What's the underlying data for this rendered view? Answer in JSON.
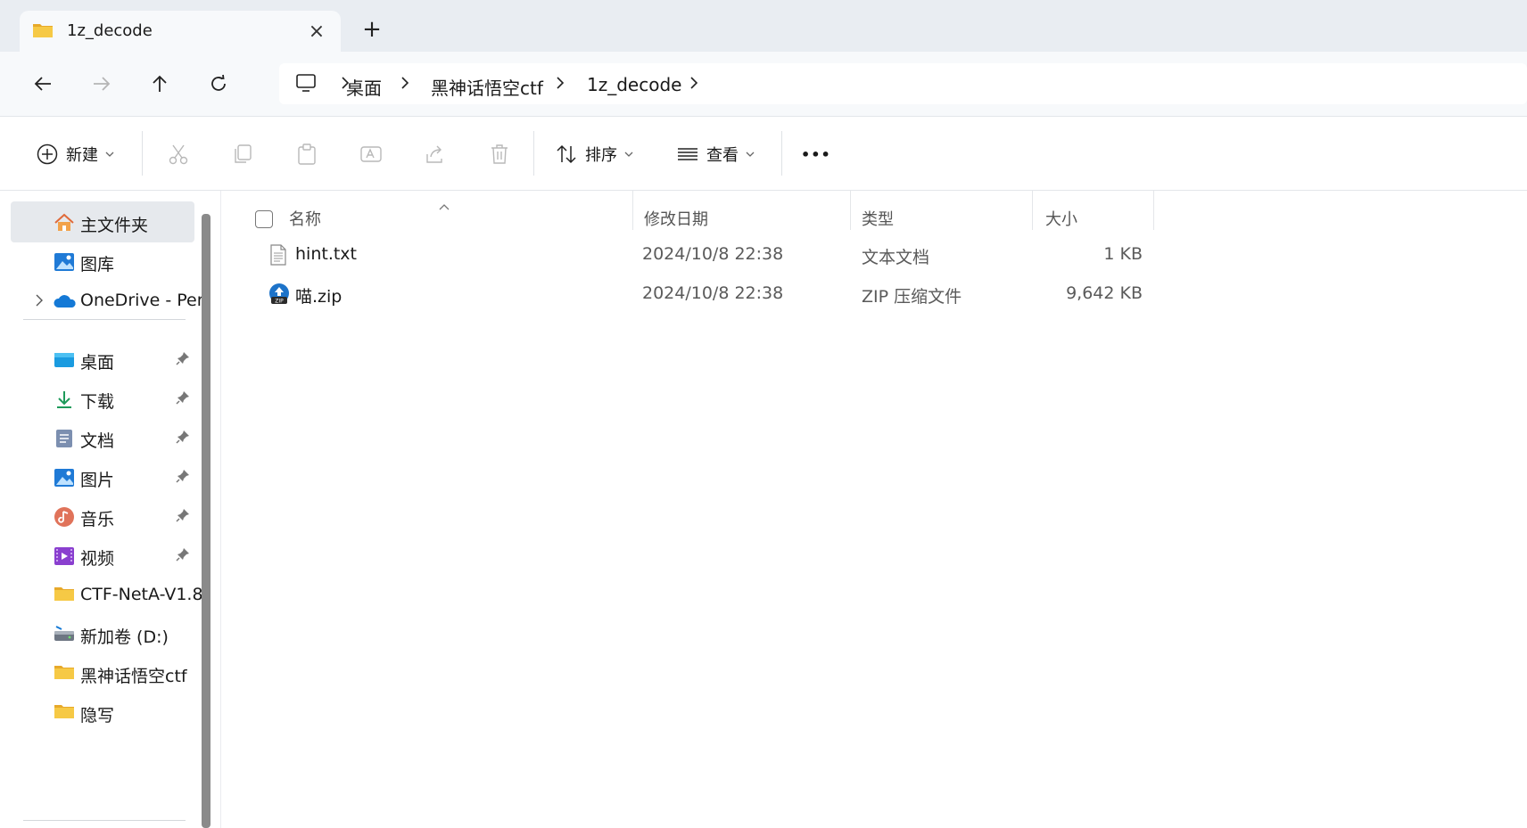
{
  "tab": {
    "title": "1z_decode",
    "close_icon": "×",
    "new_tab_icon": "+"
  },
  "breadcrumb": [
    {
      "label": "桌面"
    },
    {
      "label": "黑神话悟空ctf"
    },
    {
      "label": "1z_decode"
    }
  ],
  "toolbar": {
    "new_label": "新建",
    "sort_label": "排序",
    "view_label": "查看",
    "more_icon": "•••"
  },
  "sidebar": {
    "items": [
      {
        "label": "主文件夹",
        "icon": "home-icon"
      },
      {
        "label": "图库",
        "icon": "gallery-icon"
      },
      {
        "label": "OneDrive - Per",
        "icon": "onedrive-icon"
      },
      {
        "label": "桌面",
        "icon": "desktop-icon"
      },
      {
        "label": "下载",
        "icon": "download-icon"
      },
      {
        "label": "文档",
        "icon": "documents-icon"
      },
      {
        "label": "图片",
        "icon": "pictures-icon"
      },
      {
        "label": "音乐",
        "icon": "music-icon"
      },
      {
        "label": "视频",
        "icon": "videos-icon"
      },
      {
        "label": "CTF-NetA-V1.8",
        "icon": "folder-icon"
      },
      {
        "label": "新加卷 (D:)",
        "icon": "drive-icon"
      },
      {
        "label": "黑神话悟空ctf",
        "icon": "folder-icon"
      },
      {
        "label": "隐写",
        "icon": "folder-icon"
      }
    ]
  },
  "columns": {
    "name": "名称",
    "date": "修改日期",
    "type": "类型",
    "size": "大小"
  },
  "files": [
    {
      "name": "hint.txt",
      "date": "2024/10/8 22:38",
      "type": "文本文档",
      "size": "1 KB",
      "icon": "text-file-icon"
    },
    {
      "name": "喵.zip",
      "date": "2024/10/8 22:38",
      "type": "ZIP 压缩文件",
      "size": "9,642 KB",
      "icon": "zip-file-icon"
    }
  ],
  "colors": {
    "accent": "#0067c0",
    "folder": "#f4c542",
    "selected": "#e6e9ed"
  }
}
